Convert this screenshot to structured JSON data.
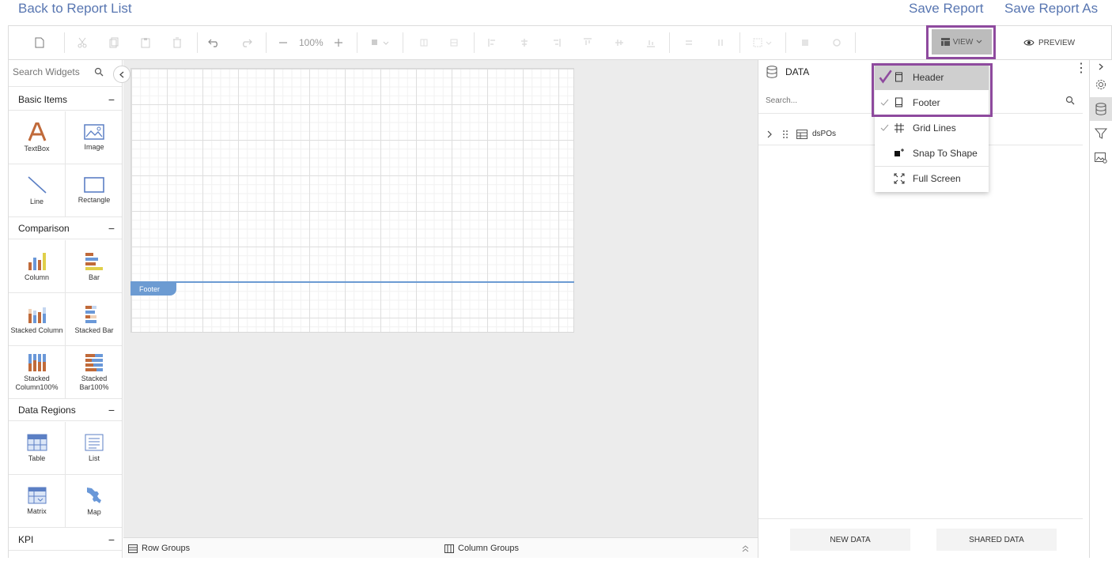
{
  "top_links": {
    "back": "Back to Report List",
    "save": "Save Report",
    "save_as": "Save Report As"
  },
  "toolbar": {
    "zoom": "100%",
    "view_label": "VIEW",
    "preview_label": "PREVIEW"
  },
  "widgets": {
    "search_placeholder": "Search Widgets",
    "sections": [
      {
        "title": "Basic Items",
        "items": [
          "TextBox",
          "Image",
          "Line",
          "Rectangle"
        ]
      },
      {
        "title": "Comparison",
        "items": [
          "Column",
          "Bar",
          "Stacked Column",
          "Stacked Bar",
          "Stacked Column100%",
          "Stacked Bar100%"
        ]
      },
      {
        "title": "Data Regions",
        "items": [
          "Table",
          "List",
          "Matrix",
          "Map"
        ]
      },
      {
        "title": "KPI",
        "items": []
      }
    ]
  },
  "canvas": {
    "footer_label": "Footer"
  },
  "groups": {
    "row": "Row Groups",
    "column": "Column Groups"
  },
  "data_panel": {
    "title": "DATA",
    "search_placeholder": "Search...",
    "datasets": [
      "dsPOs"
    ],
    "new_data": "NEW DATA",
    "shared_data": "SHARED DATA"
  },
  "view_menu": {
    "items": [
      {
        "label": "Header",
        "checked": true,
        "icon": "header-icon"
      },
      {
        "label": "Footer",
        "checked": true,
        "icon": "footer-icon"
      },
      {
        "label": "Grid Lines",
        "checked": true,
        "icon": "grid-icon"
      },
      {
        "label": "Snap To Shape",
        "checked": false,
        "icon": "snap-icon"
      },
      {
        "label": "Full Screen",
        "checked": false,
        "icon": "fullscreen-icon"
      }
    ]
  },
  "colors": {
    "link": "#5876b1",
    "highlight": "#8e4a9e",
    "footer_band": "#6c9bd2"
  }
}
